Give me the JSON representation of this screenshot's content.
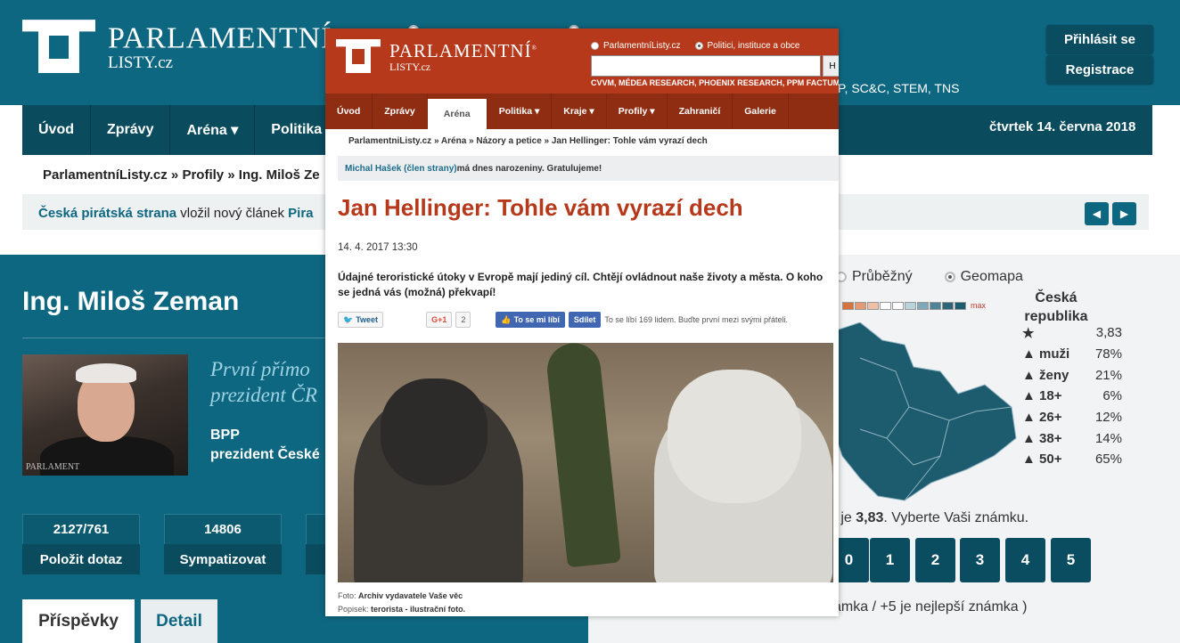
{
  "bg": {
    "logo": {
      "line1": "PARLAMENTNÍ",
      "line2": "LISTY.cz",
      "reg": "®"
    },
    "agencies_tail": "P, SC&C, STEM, TNS",
    "login": "Přihlásit se",
    "register": "Registrace",
    "nav": [
      "Úvod",
      "Zprávy",
      "Aréna ▾",
      "Politika"
    ],
    "date": "čtvrtek 14. června 2018",
    "breadcrumb": "ParlamentníListy.cz » Profily » Ing. Miloš Ze",
    "notice": {
      "link": "Česká pirátská strana",
      "text": " vložil nový článek ",
      "tail": "Pira"
    },
    "profile": {
      "name": "Ing. Miloš Zeman",
      "quote_l1": "První přímo",
      "quote_l2": "prezident ČR",
      "party": "BPP",
      "role": "prezident České",
      "photo_watermark": "PARLAMENT"
    },
    "stats": [
      {
        "value": "2127/761",
        "button": "Položit dotaz"
      },
      {
        "value": "14806",
        "button": "Sympatizovat"
      },
      {
        "value": "",
        "button": ""
      }
    ],
    "tabs": [
      "Příspěvky",
      "Detail"
    ],
    "map": {
      "type_options": [
        "Průběžný",
        "Geomapa"
      ],
      "selected": "Geomapa",
      "scale_label": "max",
      "region": "Česká republika",
      "rows": [
        {
          "icon": "star",
          "label": "",
          "value": "3,83"
        },
        {
          "icon": "person",
          "label": "muži",
          "value": "78%"
        },
        {
          "icon": "person",
          "label": "ženy",
          "value": "21%"
        },
        {
          "icon": "person",
          "label": "18+",
          "value": "6%"
        },
        {
          "icon": "person",
          "label": "26+",
          "value": "12%"
        },
        {
          "icon": "person",
          "label": "38+",
          "value": "14%"
        },
        {
          "icon": "person",
          "label": "50+",
          "value": "65%"
        }
      ],
      "avg_prefix": "a je ",
      "avg_value": "3,83",
      "avg_suffix": ". Vyberte Vaši známku.",
      "grades": [
        "0",
        "1",
        "2",
        "3",
        "4",
        "5"
      ],
      "note": "ámka / +5 je nejlepší známka )"
    },
    "colors": {
      "teal": "#0e6780",
      "dark_teal": "#0a4b5e",
      "map": "#1d5b6e"
    }
  },
  "article": {
    "logo": {
      "line1": "PARLAMENTNÍ",
      "line2": "LISTY.cz",
      "reg": "®"
    },
    "radio1": "ParlamentníListy.cz",
    "radio2": "Politici, instituce a obce",
    "search_button": "H",
    "agencies": "CVVM, MÉDEA RESEARCH, PHOENIX RESEARCH, PPM FACTUM",
    "nav": [
      "Úvod",
      "Zprávy",
      "Aréna",
      "Politika ▾",
      "Kraje ▾",
      "Profily ▾",
      "Zahraničí",
      "Galerie"
    ],
    "active_nav": "Aréna",
    "breadcrumb": "ParlamentniListy.cz » Aréna » Názory a petice » Jan Hellinger: Tohle vám vyrazí dech",
    "birthday": {
      "link": "Michal Hašek (člen strany)",
      "text": " má dnes narozeniny. Gratulujeme!"
    },
    "title": "Jan Hellinger: Tohle vám vyrazí dech",
    "date": "14. 4. 2017 13:30",
    "perex": "Údajné teroristické útoky v Evropě mají jediný cíl. Chtějí ovládnout naše životy a města. O koho se jedná vás (možná) překvapí!",
    "social": {
      "tweet": "Tweet",
      "gplus": "G+1",
      "gplus_count": "2",
      "like": "To se mi líbí",
      "share": "Sdílet",
      "like_text": "To se líbí 169 lidem. Buďte první mezi svými přáteli."
    },
    "photo_label": "Foto:",
    "photo_source": "Archiv vydavatele Vaše věc",
    "caption_label": "Popisek:",
    "caption": "terorista - ilustrační foto.",
    "colors": {
      "brand": "#b5391a",
      "nav": "#8e2d12"
    }
  }
}
